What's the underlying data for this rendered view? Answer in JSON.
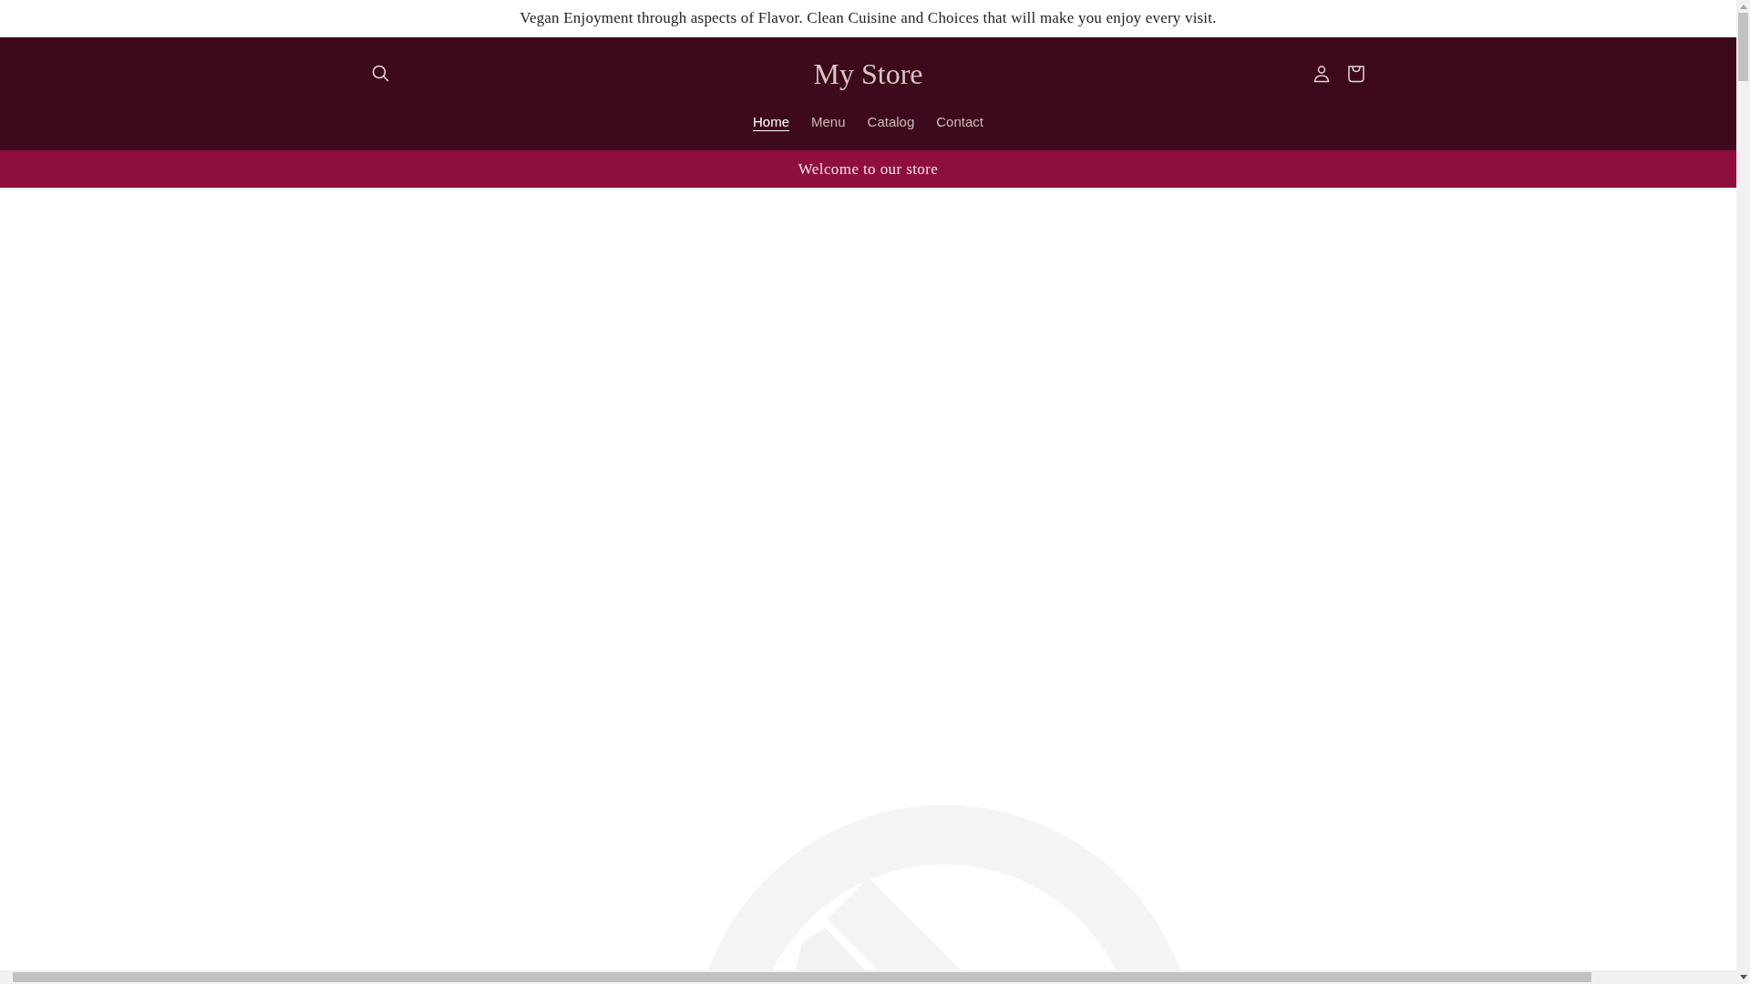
{
  "announcement": {
    "text": "Vegan Enjoyment through aspects of Flavor. Clean Cuisine and Choices that will make you enjoy every visit."
  },
  "header": {
    "store_name": "My Store",
    "nav": [
      {
        "label": "Home",
        "selected": true
      },
      {
        "label": "Menu",
        "selected": false
      },
      {
        "label": "Catalog",
        "selected": false
      },
      {
        "label": "Contact",
        "selected": false
      }
    ]
  },
  "welcome_bar": {
    "text": "Welcome to our store"
  }
}
